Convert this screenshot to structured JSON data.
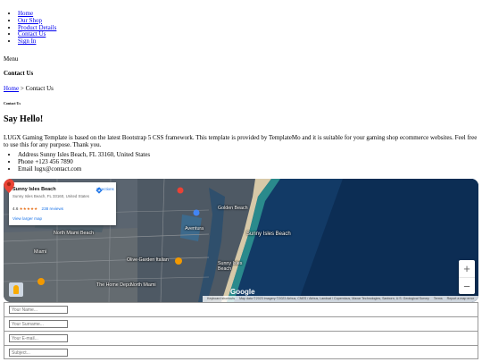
{
  "nav": {
    "items": [
      {
        "label": "Home"
      },
      {
        "label": "Our Shop"
      },
      {
        "label": "Product Details"
      },
      {
        "label": "Contact Us"
      },
      {
        "label": "Sign In"
      }
    ]
  },
  "menu_label": "Menu",
  "page_heading": "Contact Us",
  "breadcrumb": {
    "home": "Home",
    "separator": " > ",
    "current": "Contact Us"
  },
  "section_label": "Contact Us",
  "hello_title": "Say Hello!",
  "intro_text": "LUGX Gaming Template is based on the latest Bootstrap 5 CSS framework. This template is provided by TemplateMo and it is suitable for your gaming shop ecommerce websites. Feel free to use this for any purpose. Thank you.",
  "contact_info": [
    {
      "text": "Address Sunny Isles Beach, FL 33160, United States"
    },
    {
      "text": "Phone +123 456 7890"
    },
    {
      "text": "Email lugx@contact.com"
    }
  ],
  "map": {
    "card": {
      "place": "Sunny Isles Beach",
      "address": "Sunny Isles Beach, FL 33160, United States",
      "rating": "4.6",
      "stars": "★★★★★",
      "reviews": "238 reviews",
      "larger_map": "View larger map",
      "directions": "Directions"
    },
    "labels": [
      "Sunny Isles Beach",
      "Golden Beach",
      "North Miami Beach",
      "Aventura",
      "Olive Garden Italian",
      "Miami",
      "Sunny Isles Beach",
      "The Home Depot",
      "North Miami"
    ],
    "zoom_in": "+",
    "zoom_out": "−",
    "google": "Google",
    "attribution": {
      "shortcuts": "Keyboard shortcuts",
      "data": "Map data ©2023 Imagery ©2023 Airbus, CNES / Airbus, Landsat / Copernicus, Maxar Technologies, Sanborn, U.S. Geological Survey",
      "terms": "Terms",
      "report": "Report a map error"
    },
    "colors": {
      "ocean": "#123a66",
      "land": "#56606a",
      "beach": "#d7c9a8",
      "pin": "#ea4335"
    }
  },
  "form": {
    "name_placeholder": "Your Name...",
    "surname_placeholder": "Your Surname...",
    "email_placeholder": "Your E-mail...",
    "subject_placeholder": "Subject..."
  }
}
